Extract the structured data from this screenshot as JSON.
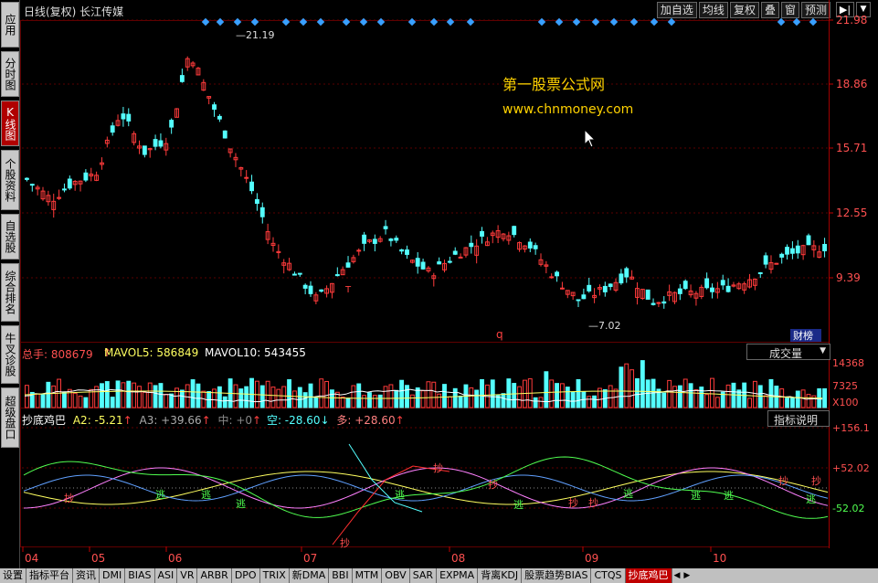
{
  "sidebar": {
    "tabs": [
      {
        "label": "应用",
        "icon": "k-icon",
        "active": false
      },
      {
        "label": "分时图",
        "active": false
      },
      {
        "label": "K线图",
        "active": true
      },
      {
        "label": "个股资料",
        "active": false
      },
      {
        "label": "自选股",
        "active": false
      },
      {
        "label": "综合排名",
        "active": false
      },
      {
        "label": "牛叉诊股",
        "active": false
      },
      {
        "label": "超级盘口",
        "active": false
      }
    ]
  },
  "header": {
    "title": "日线(复权)  长江传媒",
    "toolbar": [
      "加自选",
      "均线",
      "复权",
      "叠",
      "窗",
      "预测"
    ],
    "arrows_icon": "▶|",
    "dropdown_icon": "▼"
  },
  "price_panel": {
    "y_ticks": [
      "21.98",
      "18.86",
      "15.71",
      "12.55",
      "9.39"
    ],
    "high_label": "21.19",
    "low_label": "7.02",
    "watermark_title": "第一股票公式网",
    "watermark_url": "www.chnmoney.com",
    "badge": "财榜",
    "marker_q": "q",
    "marker_t": "T",
    "colors": {
      "up": "#ff3b3b",
      "down": "#54ffff",
      "grid": "#5a0000",
      "watermark": "#ffd200"
    }
  },
  "volume_panel": {
    "label_total": "总手: 808679",
    "label_ma5": "MAVOL5: 586849",
    "label_ma10": "MAVOL10: 543455",
    "select_value": "成交量",
    "y_ticks": [
      "14368",
      "7325",
      "X100"
    ]
  },
  "indicator_panel": {
    "name": "抄底鸡巴",
    "a2": "A2: -5.21",
    "a3": "A3: +39.66",
    "mid": "中: +0",
    "kong": "空: -28.60",
    "duo": "多: +28.60",
    "help_button": "指标说明",
    "y_ticks": [
      "+156.1",
      "+52.02",
      "-52.02"
    ],
    "signal_buy": "抄",
    "signal_escape": "逃"
  },
  "x_axis": {
    "months": [
      "04",
      "05",
      "06",
      "07",
      "08",
      "09",
      "10"
    ]
  },
  "bottom_tabs": [
    "设置",
    "指标平台",
    "资讯",
    "DMI",
    "BIAS",
    "ASI",
    "VR",
    "ARBR",
    "DPO",
    "TRIX",
    "新DMA",
    "BBI",
    "MTM",
    "OBV",
    "SAR",
    "EXPMA",
    "背离KDJ",
    "股票趋势BIAS",
    "CTQS",
    "抄底鸡巴"
  ],
  "bottom_nav": [
    "◀",
    "▶"
  ]
}
